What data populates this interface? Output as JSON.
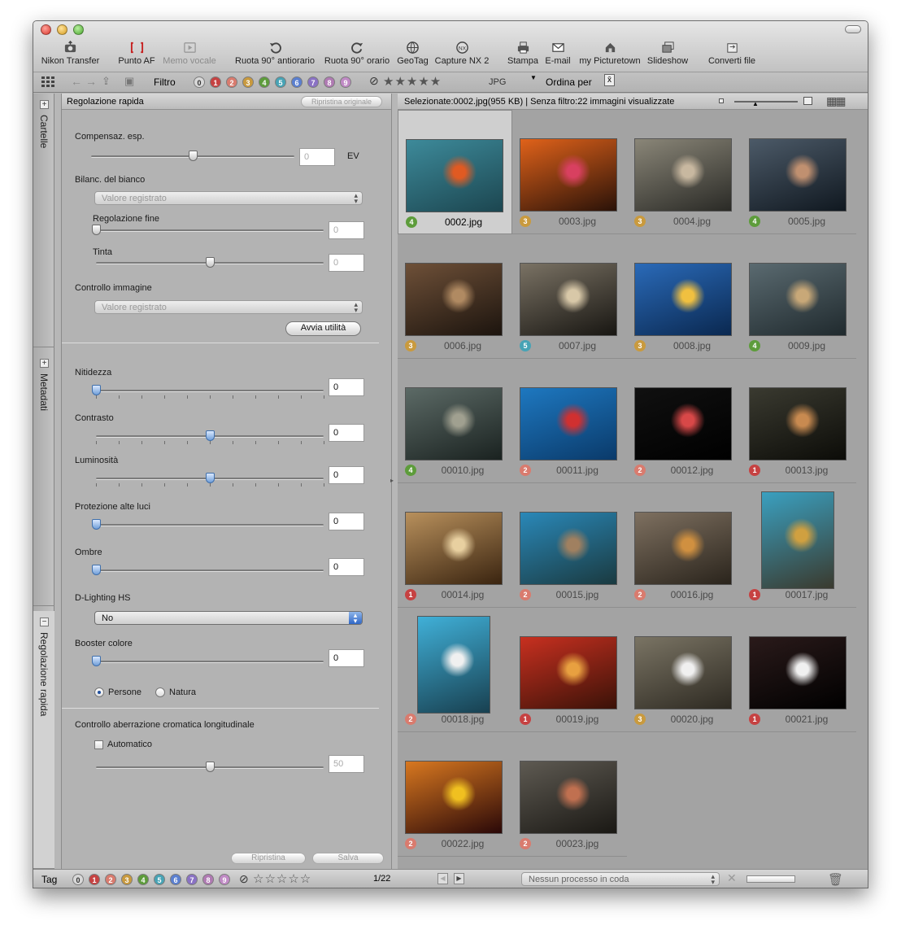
{
  "toolbar": {
    "buttons": [
      {
        "label": "Nikon Transfer",
        "icon": "camera-transfer-icon",
        "enabled": true
      },
      {
        "label": "Punto AF",
        "icon": "af-point-icon",
        "enabled": true
      },
      {
        "label": "Memo vocale",
        "icon": "voice-memo-icon",
        "enabled": false
      },
      {
        "label": "Ruota 90° antiorario",
        "icon": "rotate-left-icon",
        "enabled": true
      },
      {
        "label": "Ruota 90° orario",
        "icon": "rotate-right-icon",
        "enabled": true
      },
      {
        "label": "GeoTag",
        "icon": "globe-icon",
        "enabled": true
      },
      {
        "label": "Capture NX 2",
        "icon": "capture-nx-icon",
        "enabled": true
      },
      {
        "label": "Stampa",
        "icon": "print-icon",
        "enabled": true
      },
      {
        "label": "E-mail",
        "icon": "envelope-icon",
        "enabled": true
      },
      {
        "label": "my Picturetown",
        "icon": "picturetown-icon",
        "enabled": true
      },
      {
        "label": "Slideshow",
        "icon": "slideshow-icon",
        "enabled": true
      },
      {
        "label": "Converti file",
        "icon": "convert-file-icon",
        "enabled": true
      }
    ]
  },
  "filterbar": {
    "filter_label": "Filtro",
    "labels": [
      "0",
      "1",
      "2",
      "3",
      "4",
      "5",
      "6",
      "7",
      "8",
      "9"
    ],
    "stars": "★★★★★",
    "file_type": "JPG",
    "sort_label": "Ordina per"
  },
  "label_colors": [
    "#d8d8d8",
    "#c64242",
    "#d97b6e",
    "#c99a3e",
    "#5d9c3b",
    "#47a3b5",
    "#5a7fd0",
    "#8a72c4",
    "#b07ab3",
    "#c08ac5"
  ],
  "side_tabs": {
    "folders": "Cartelle",
    "metadata": "Metadati",
    "quick": "Regolazione rapida"
  },
  "panel": {
    "title": "Regolazione rapida",
    "reset_original": "Ripristina originale",
    "exposure": {
      "label": "Compensaz. esp.",
      "value": "0",
      "unit": "EV",
      "level": 0.5
    },
    "white_balance": {
      "label": "Bilanc. del bianco",
      "value": "Valore registrato"
    },
    "fine_adj": {
      "label": "Regolazione fine",
      "value": "0",
      "level": 0
    },
    "tint": {
      "label": "Tinta",
      "value": "0",
      "level": 0.5
    },
    "image_control": {
      "label": "Controllo immagine",
      "value": "Valore registrato"
    },
    "launch_utility": "Avvia utilità",
    "sharpness": {
      "label": "Nitidezza",
      "value": "0",
      "level": 0
    },
    "contrast": {
      "label": "Contrasto",
      "value": "0",
      "level": 0.5
    },
    "brightness": {
      "label": "Luminosità",
      "value": "0",
      "level": 0.5
    },
    "highlights": {
      "label": "Protezione alte luci",
      "value": "0",
      "level": 0
    },
    "shadows": {
      "label": "Ombre",
      "value": "0",
      "level": 0
    },
    "dlighting": {
      "label": "D-Lighting HS",
      "value": "No"
    },
    "color_booster": {
      "label": "Booster colore",
      "value": "0",
      "level": 0
    },
    "people": "Persone",
    "nature": "Natura",
    "aberration": {
      "label": "Controllo aberrazione cromatica longitudinale",
      "auto": "Automatico",
      "value": "50",
      "level": 0.5
    },
    "reset": "Ripristina",
    "save": "Salva"
  },
  "status": "Selezionate:0002.jpg(955 KB) | Senza filtro:22 immagini visualizzate",
  "images": [
    {
      "name": "0002.jpg",
      "label": "4",
      "selected": true,
      "a": "#3d8a9a",
      "b": "#1c4650",
      "accent": "#e05a22",
      "portrait": false
    },
    {
      "name": "0003.jpg",
      "label": "3",
      "a": "#e0621a",
      "b": "#2a1208",
      "accent": "#d84060",
      "portrait": false
    },
    {
      "name": "0004.jpg",
      "label": "3",
      "a": "#8a8678",
      "b": "#2a2a26",
      "accent": "#c8b8a0",
      "portrait": false
    },
    {
      "name": "0005.jpg",
      "label": "4",
      "a": "#4c5a68",
      "b": "#101820",
      "accent": "#c09070",
      "portrait": false
    },
    {
      "name": "0006.jpg",
      "label": "3",
      "a": "#6e5038",
      "b": "#1c140e",
      "accent": "#b08a62",
      "portrait": false
    },
    {
      "name": "0007.jpg",
      "label": "5",
      "a": "#7a7264",
      "b": "#181612",
      "accent": "#d8c8a8",
      "portrait": false
    },
    {
      "name": "0008.jpg",
      "label": "3",
      "a": "#2a6ab8",
      "b": "#0a2850",
      "accent": "#f0c040",
      "portrait": false
    },
    {
      "name": "0009.jpg",
      "label": "4",
      "a": "#5a6a70",
      "b": "#202a2e",
      "accent": "#c8a878",
      "portrait": false
    },
    {
      "name": "00010.jpg",
      "label": "4",
      "a": "#5c6a66",
      "b": "#1a2220",
      "accent": "#a0a090",
      "portrait": false
    },
    {
      "name": "00011.jpg",
      "label": "2",
      "a": "#1e78c0",
      "b": "#0a3a6a",
      "accent": "#d03030",
      "portrait": false
    },
    {
      "name": "00012.jpg",
      "label": "2",
      "a": "#101010",
      "b": "#000000",
      "accent": "#d84848",
      "portrait": false
    },
    {
      "name": "00013.jpg",
      "label": "1",
      "a": "#3a3a30",
      "b": "#0c0c08",
      "accent": "#c88a50",
      "portrait": false
    },
    {
      "name": "00014.jpg",
      "label": "1",
      "a": "#b8905c",
      "b": "#3a2410",
      "accent": "#e8d0a0",
      "portrait": false
    },
    {
      "name": "00015.jpg",
      "label": "2",
      "a": "#2a88b8",
      "b": "#1a3a40",
      "accent": "#a08060",
      "portrait": false
    },
    {
      "name": "00016.jpg",
      "label": "2",
      "a": "#7e7060",
      "b": "#2a241c",
      "accent": "#d09040",
      "portrait": false
    },
    {
      "name": "00017.jpg",
      "label": "1",
      "a": "#3aa0c0",
      "b": "#3a3a2e",
      "accent": "#d0a040",
      "portrait": true
    },
    {
      "name": "00018.jpg",
      "label": "2",
      "a": "#40b0d8",
      "b": "#184050",
      "accent": "#f0f0f0",
      "portrait": true
    },
    {
      "name": "00019.jpg",
      "label": "1",
      "a": "#c83020",
      "b": "#3a1208",
      "accent": "#e8a040",
      "portrait": false
    },
    {
      "name": "00020.jpg",
      "label": "3",
      "a": "#7a7464",
      "b": "#2e2a22",
      "accent": "#f0f0f0",
      "portrait": false
    },
    {
      "name": "00021.jpg",
      "label": "1",
      "a": "#2a1a1a",
      "b": "#000000",
      "accent": "#f0f0f0",
      "portrait": false
    },
    {
      "name": "00022.jpg",
      "label": "2",
      "a": "#d87820",
      "b": "#2a0808",
      "accent": "#f0c020",
      "portrait": false
    },
    {
      "name": "00023.jpg",
      "label": "2",
      "a": "#5e5a52",
      "b": "#1a1814",
      "accent": "#c07050",
      "portrait": false
    }
  ],
  "bottombar": {
    "tag_label": "Tag",
    "labels": [
      "0",
      "1",
      "2",
      "3",
      "4",
      "5",
      "6",
      "7",
      "8",
      "9"
    ],
    "stars": "☆☆☆☆☆",
    "page": "1/22",
    "queue": "Nessun processo in coda"
  }
}
